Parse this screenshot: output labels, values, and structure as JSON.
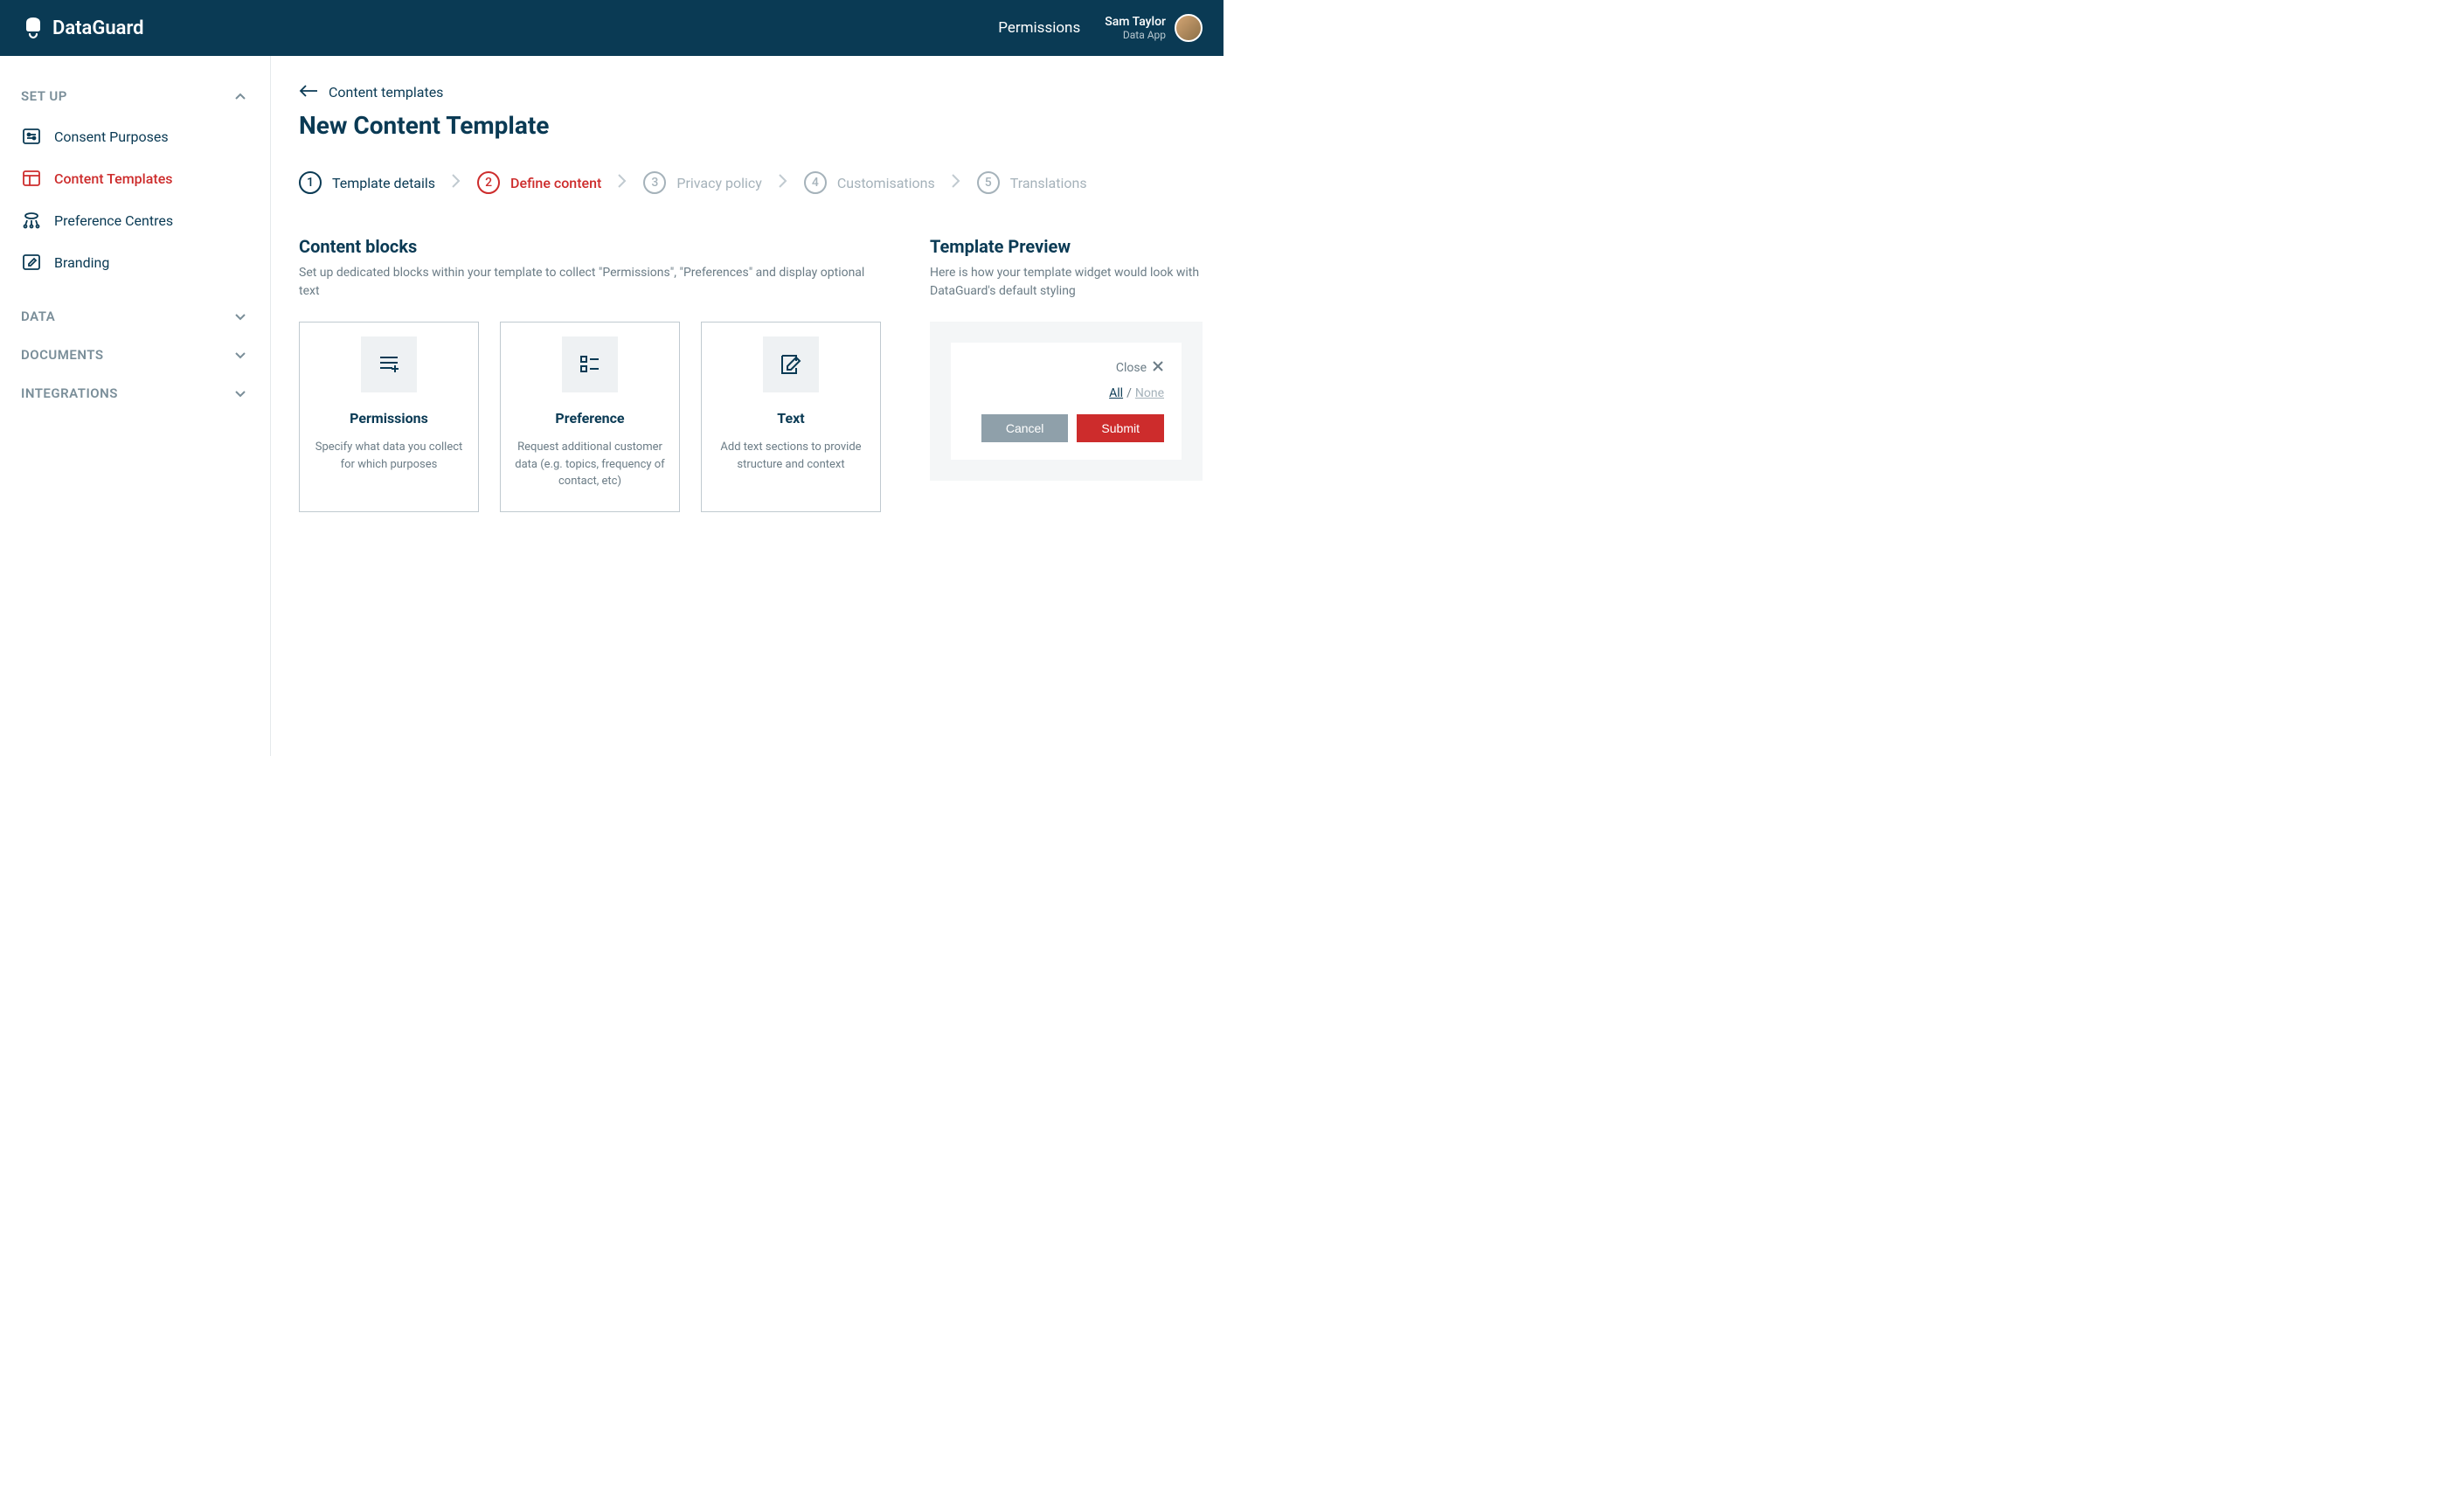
{
  "header": {
    "logo": "DataGuard",
    "link": "Permissions",
    "user_name": "Sam Taylor",
    "user_sub": "Data App"
  },
  "sidebar": {
    "sections": [
      {
        "label": "SET UP",
        "expanded": true
      },
      {
        "label": "DATA",
        "expanded": false
      },
      {
        "label": "DOCUMENTS",
        "expanded": false
      },
      {
        "label": "INTEGRATIONS",
        "expanded": false
      }
    ],
    "items": [
      {
        "label": "Consent Purposes"
      },
      {
        "label": "Content Templates"
      },
      {
        "label": "Preference Centres"
      },
      {
        "label": "Branding"
      }
    ]
  },
  "breadcrumb": "Content templates",
  "page_title": "New Content Template",
  "stepper": [
    {
      "num": "1",
      "label": "Template details"
    },
    {
      "num": "2",
      "label": "Define content"
    },
    {
      "num": "3",
      "label": "Privacy policy"
    },
    {
      "num": "4",
      "label": "Customisations"
    },
    {
      "num": "5",
      "label": "Translations"
    }
  ],
  "content_blocks": {
    "title": "Content blocks",
    "desc": "Set up dedicated blocks within your template to collect \"Permissions\", \"Preferences\" and display optional text",
    "cards": [
      {
        "title": "Permissions",
        "desc": "Specify what data you collect for which purposes"
      },
      {
        "title": "Preference",
        "desc": "Request additional customer data (e.g. topics, frequency of contact, etc)"
      },
      {
        "title": "Text",
        "desc": "Add text sections to provide structure and context"
      }
    ]
  },
  "preview": {
    "title": "Template Preview",
    "desc": "Here is how your template widget would look with DataGuard's default styling",
    "close": "Close",
    "all": "All",
    "none": "None",
    "cancel": "Cancel",
    "submit": "Submit"
  }
}
